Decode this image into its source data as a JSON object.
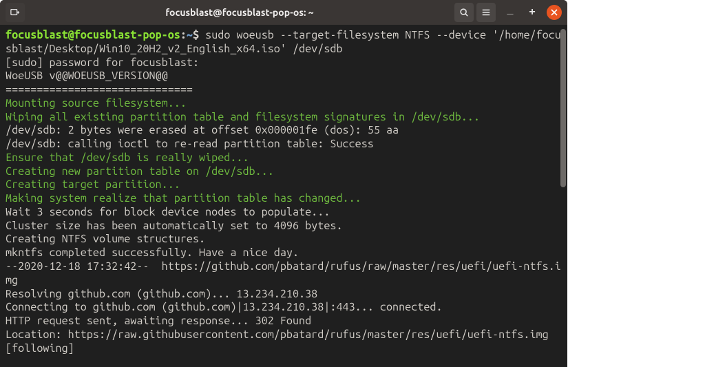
{
  "titlebar": {
    "title": "focusblast@focusblast-pop-os: ~"
  },
  "prompt": {
    "userhost": "focusblast@focusblast-pop-os",
    "colon": ":",
    "path": "~",
    "dollar": "$"
  },
  "command": " sudo woeusb --target-filesystem NTFS --device '/home/focusblast/Desktop/Win10_20H2_v2_English_x64.iso' /dev/sdb",
  "lines": {
    "l1": "[sudo] password for focusblast:",
    "l2": "WoeUSB v@@WOEUSB_VERSION@@",
    "l3": "==============================",
    "l4": "Mounting source filesystem...",
    "l5": "Wiping all existing partition table and filesystem signatures in /dev/sdb...",
    "l6": "/dev/sdb: 2 bytes were erased at offset 0x000001fe (dos): 55 aa",
    "l7": "/dev/sdb: calling ioctl to re-read partition table: Success",
    "l8": "Ensure that /dev/sdb is really wiped...",
    "l9": "Creating new partition table on /dev/sdb...",
    "l10": "Creating target partition...",
    "l11": "Making system realize that partition table has changed...",
    "l12": "Wait 3 seconds for block device nodes to populate...",
    "l13": "Cluster size has been automatically set to 4096 bytes.",
    "l14": "Creating NTFS volume structures.",
    "l15": "mkntfs completed successfully. Have a nice day.",
    "l16": "--2020-12-18 17:32:42--  https://github.com/pbatard/rufus/raw/master/res/uefi/uefi-ntfs.img",
    "l17": "Resolving github.com (github.com)... 13.234.210.38",
    "l18": "Connecting to github.com (github.com)|13.234.210.38|:443... connected.",
    "l19": "HTTP request sent, awaiting response... 302 Found",
    "l20": "Location: https://raw.githubusercontent.com/pbatard/rufus/master/res/uefi/uefi-ntfs.img [following]"
  }
}
